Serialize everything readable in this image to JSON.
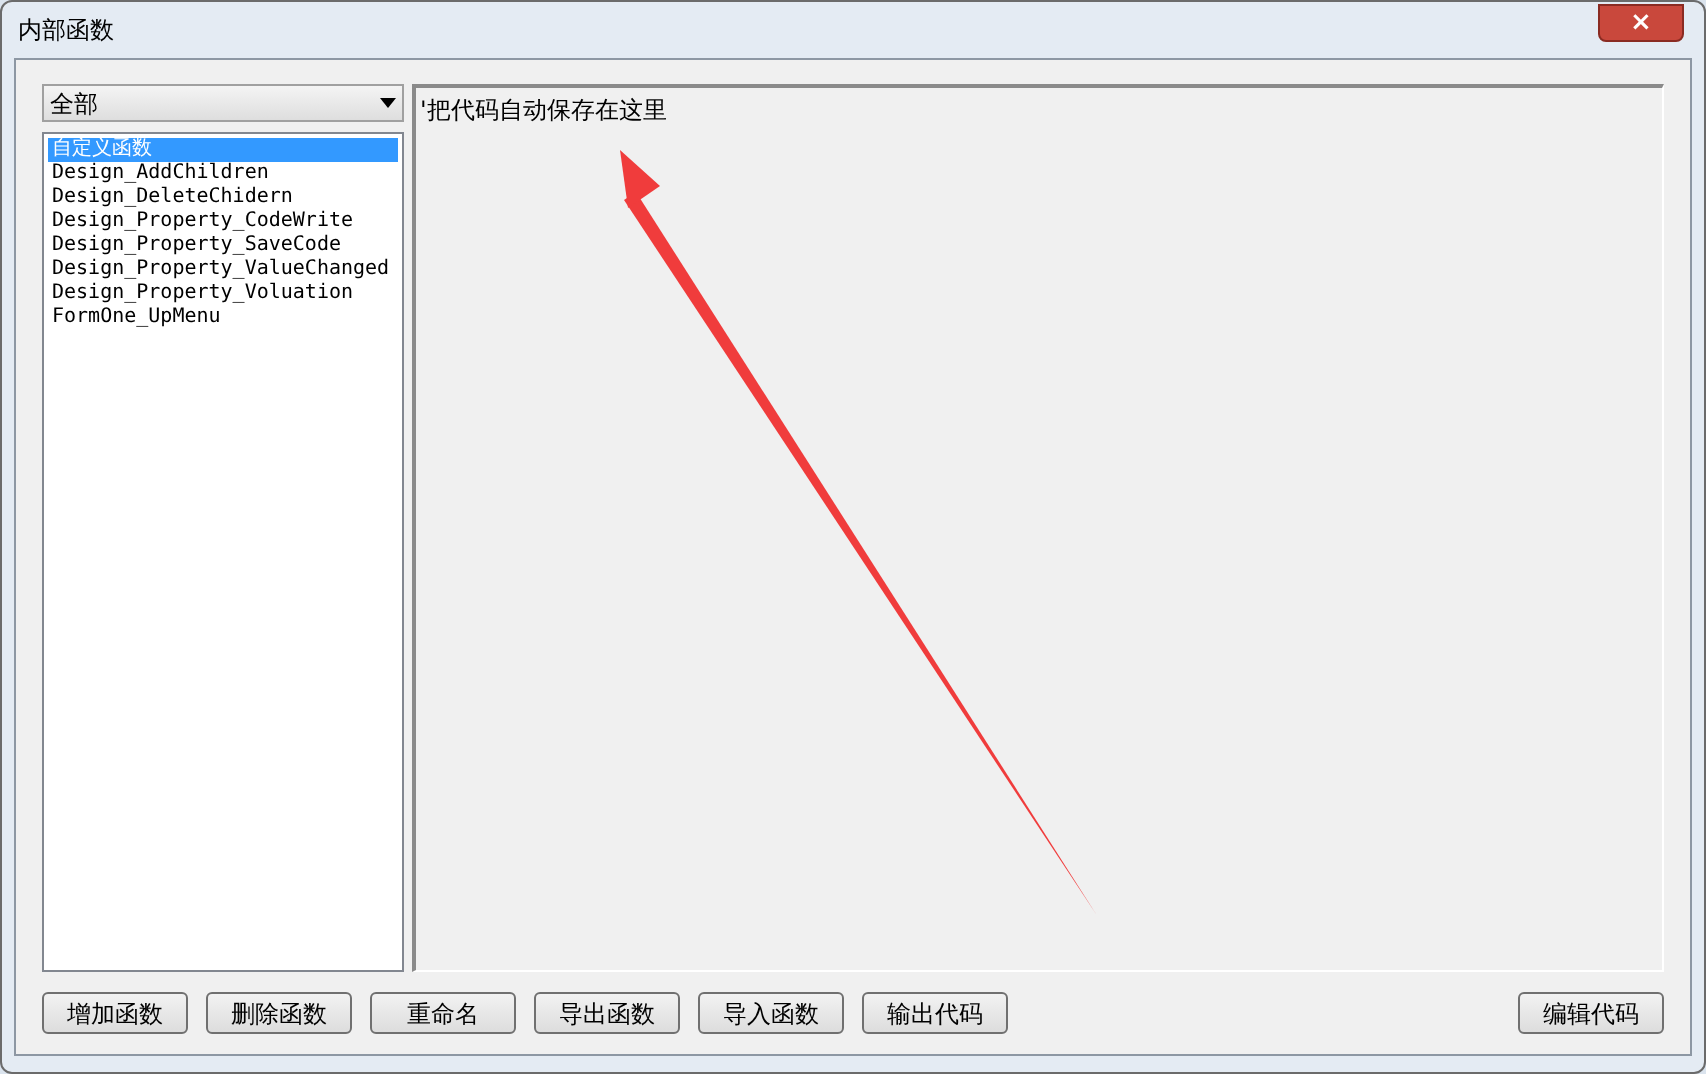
{
  "window": {
    "title": "内部函数",
    "close": "×"
  },
  "filter": {
    "value": "全部"
  },
  "functions": [
    {
      "name": "自定义函数",
      "selected": true
    },
    {
      "name": "Design_AddChildren",
      "selected": false
    },
    {
      "name": "Design_DeleteChidern",
      "selected": false
    },
    {
      "name": "Design_Property_CodeWrite",
      "selected": false
    },
    {
      "name": "Design_Property_SaveCode",
      "selected": false
    },
    {
      "name": "Design_Property_ValueChanged",
      "selected": false
    },
    {
      "name": "Design_Property_Voluation",
      "selected": false
    },
    {
      "name": "FormOne_UpMenu",
      "selected": false
    }
  ],
  "editor": {
    "value": "'把代码自动保存在这里"
  },
  "buttons": [
    "增加函数",
    "删除函数",
    "重命名",
    "导出函数",
    "导入函数",
    "输出代码"
  ],
  "edit_button": "编辑代码"
}
